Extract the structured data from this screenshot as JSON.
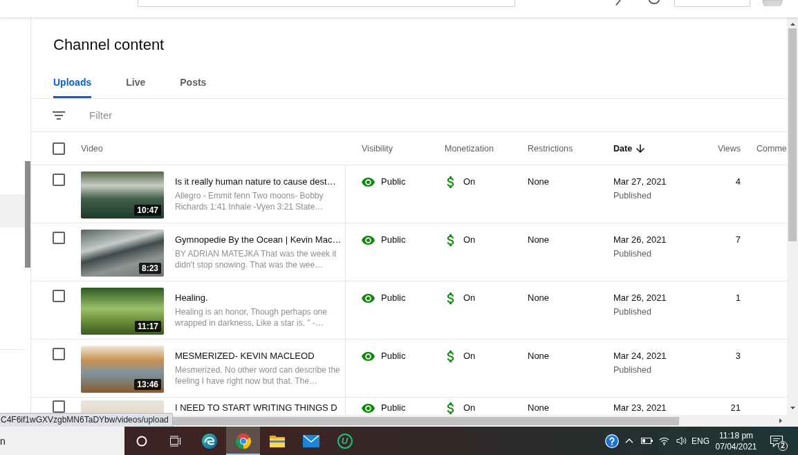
{
  "page": {
    "title": "Channel content"
  },
  "tabs": [
    {
      "label": "Uploads",
      "selected": true
    },
    {
      "label": "Live",
      "selected": false
    },
    {
      "label": "Posts",
      "selected": false
    }
  ],
  "filter": {
    "placeholder": "Filter"
  },
  "table": {
    "select_all": {
      "checked": false
    },
    "columns": [
      {
        "label": "Video",
        "sorted": false
      },
      {
        "label": "Visibility",
        "sorted": false
      },
      {
        "label": "Monetization",
        "sorted": false
      },
      {
        "label": "Restrictions",
        "sorted": false
      },
      {
        "label": "Date",
        "sorted": true
      },
      {
        "label": "Views",
        "sorted": false
      },
      {
        "label": "Comme",
        "sorted": false
      }
    ],
    "rows": [
      {
        "checked": false,
        "duration": "10:47",
        "title": "Is it really human nature to cause dest…",
        "description": "Allegro - Emmit fenn Two moons- Bobby Richards 1:41 Inhale -Vyen 3:21 State…",
        "visibility": "Public",
        "monetization": "On",
        "restrictions": "None",
        "date": "Mar 27, 2021",
        "status": "Published",
        "views": "4"
      },
      {
        "checked": false,
        "duration": "8:23",
        "title": "Gymnopedie By the Ocean | Kevin Mac…",
        "description": "BY ADRIAN MATEJKA That was the week it didn't stop snowing. That was the wee…",
        "visibility": "Public",
        "monetization": "On",
        "restrictions": "None",
        "date": "Mar 26, 2021",
        "status": "Published",
        "views": "7"
      },
      {
        "checked": false,
        "duration": "11:17",
        "title": "Healing.",
        "description": "Healing is an honor, Though perhaps one wrapped in darkness, Like a star is. \" -…",
        "visibility": "Public",
        "monetization": "On",
        "restrictions": "None",
        "date": "Mar 26, 2021",
        "status": "Published",
        "views": "1"
      },
      {
        "checked": false,
        "duration": "13:46",
        "title": "MESMERIZED- KEVIN MACLEOD",
        "description": "Mesmerized. No other word can describe the feeling I have right now but that. The…",
        "visibility": "Public",
        "monetization": "On",
        "restrictions": "None",
        "date": "Mar 24, 2021",
        "status": "Published",
        "views": "3"
      },
      {
        "checked": false,
        "title": "I NEED TO START WRITING THINGS D",
        "visibility": "Public",
        "monetization": "On",
        "restrictions": "None",
        "date": "Mar 23, 2021",
        "views": "21"
      }
    ]
  },
  "status_url": "C4F6if1wGXVzgbMN6TaDYbw/videos/upload",
  "taskbar": {
    "search": {
      "text": "n"
    },
    "apps": [
      {
        "kind": "ring",
        "active": false
      },
      {
        "kind": "task_view",
        "active": false
      },
      {
        "kind": "swirl",
        "active": false
      },
      {
        "kind": "browser",
        "active": true
      },
      {
        "kind": "folder",
        "active": false
      },
      {
        "kind": "mail",
        "active": false
      },
      {
        "kind": "letter",
        "glyph": "U",
        "active": false
      }
    ],
    "tray": {
      "language": "ENG",
      "time": "11:18 pm",
      "date": "07/04/2021",
      "notification_count": "2"
    }
  }
}
